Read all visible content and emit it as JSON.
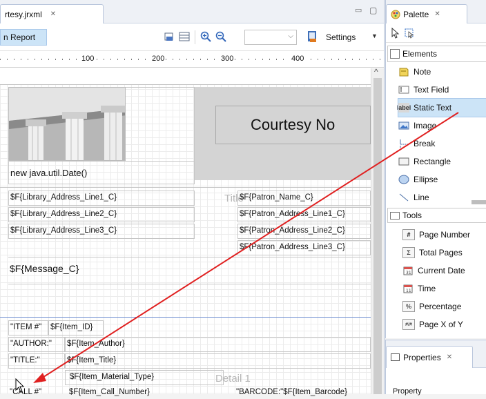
{
  "editor": {
    "tab_title": "rtesy.jrxml",
    "close_glyph": "✕",
    "min_glyph": "▭",
    "max_glyph": "▢",
    "report_tab": "n Report",
    "settings_label": "Settings",
    "zoom_value": ""
  },
  "ruler": {
    "labels": [
      "100",
      "200",
      "300",
      "400"
    ]
  },
  "report": {
    "title_text": "Courtesy No",
    "date_expr": "new java.util.Date()",
    "title_band_label": "Title",
    "detail_band_label": "Detail 1",
    "lib_lines": [
      "$F{Library_Address_Line1_C}",
      "$F{Library_Address_Line2_C}",
      "$F{Library_Address_Line3_C}"
    ],
    "patron_lines": [
      "$F{Patron_Name_C}",
      "$F{Patron_Address_Line1_C}",
      "$F{Patron_Address_Line2_C}",
      "$F{Patron_Address_Line3_C}"
    ],
    "message": "$F{Message_C}",
    "item_label": "\"ITEM #\"",
    "item_id": "$F{Item_ID}",
    "author_label": "\"AUTHOR:\"",
    "author_field": "$F{Item_Author}",
    "title_label": "\"TITLE:\"",
    "title_field": "$F{Item_Title}",
    "material_field": "$F{Item_Material_Type}",
    "bottom_left": "\"CALL #\"",
    "bottom_mid": "$F{Item_Call_Number}",
    "bottom_right": "\"BARCODE:\"$F{Item_Barcode}"
  },
  "palette": {
    "title": "Palette",
    "elements_header": "Elements",
    "elements": [
      "Note",
      "Text Field",
      "Static Text",
      "Image",
      "Break",
      "Rectangle",
      "Ellipse",
      "Line"
    ],
    "tools_header": "Tools",
    "tools": [
      "Page Number",
      "Total Pages",
      "Current Date",
      "Time",
      "Percentage",
      "Page X of Y"
    ]
  },
  "properties": {
    "title": "Properties",
    "col_property": "Property"
  },
  "colors": {
    "accent_blue": "#3f77c8",
    "selection": "#cce4f7",
    "arrow": "#e02020"
  }
}
